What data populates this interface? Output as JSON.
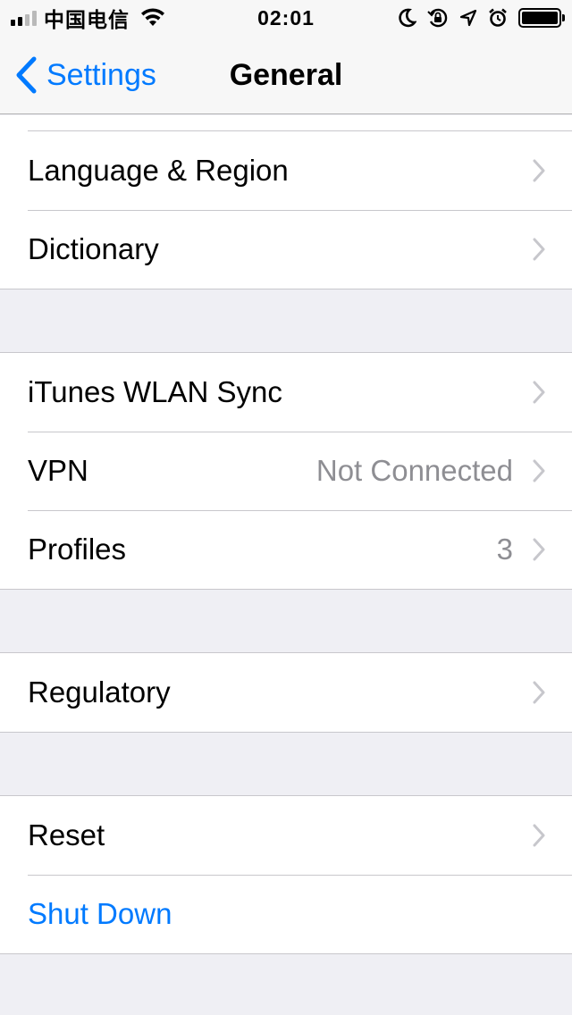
{
  "status_bar": {
    "carrier": "中国电信",
    "time": "02:01",
    "signal_bars_filled": 2,
    "signal_bars_total": 4,
    "battery_level": 1.0,
    "icons": [
      "moon-icon",
      "rotation-lock-icon",
      "location-icon",
      "alarm-icon"
    ]
  },
  "nav": {
    "back_label": "Settings",
    "title": "General"
  },
  "groups": [
    {
      "rows": [
        {
          "label": "Language & Region",
          "value": "",
          "chevron": true
        },
        {
          "label": "Dictionary",
          "value": "",
          "chevron": true
        }
      ]
    },
    {
      "rows": [
        {
          "label": "iTunes WLAN Sync",
          "value": "",
          "chevron": true
        },
        {
          "label": "VPN",
          "value": "Not Connected",
          "chevron": true
        },
        {
          "label": "Profiles",
          "value": "3",
          "chevron": true
        }
      ]
    },
    {
      "rows": [
        {
          "label": "Regulatory",
          "value": "",
          "chevron": true
        }
      ]
    },
    {
      "rows": [
        {
          "label": "Reset",
          "value": "",
          "chevron": true
        },
        {
          "label": "Shut Down",
          "value": "",
          "chevron": false,
          "link": true
        }
      ]
    }
  ],
  "colors": {
    "accent": "#007aff",
    "background": "#efeff4",
    "secondary_text": "#8e8e93",
    "separator": "#c8c7cc"
  }
}
